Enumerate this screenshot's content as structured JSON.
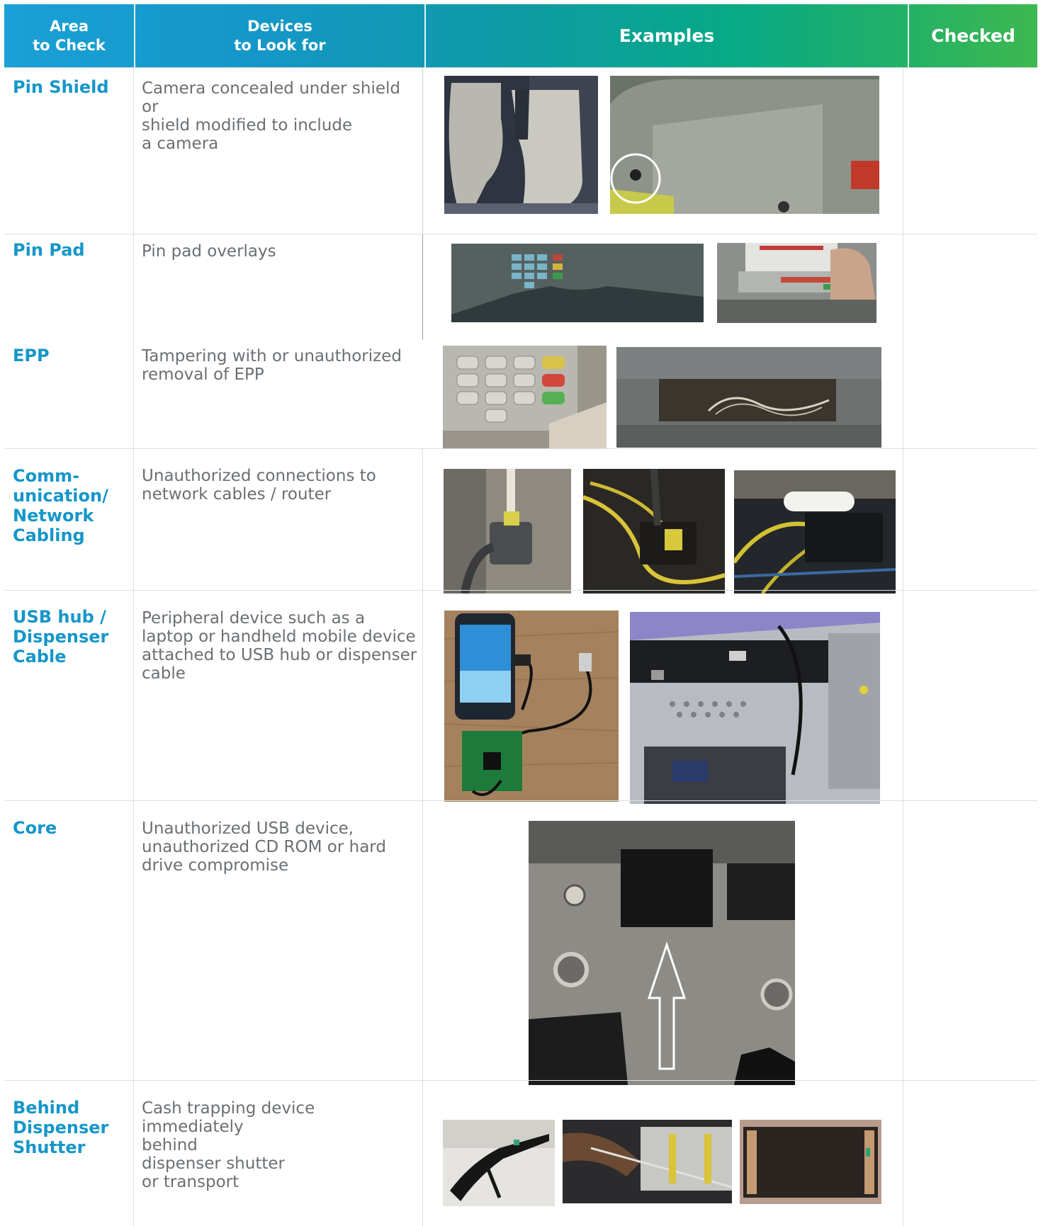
{
  "header": {
    "col1": "Area\nto Check",
    "col2": "Devices\nto Look for",
    "col3": "Examples",
    "col4": "Checked"
  },
  "rows": [
    {
      "area": "Pin Shield",
      "devices": "Camera concealed under shield or\nshield modified to include\na camera",
      "checked": ""
    },
    {
      "area": "Pin Pad",
      "devices": "Pin pad overlays",
      "checked": ""
    },
    {
      "area": "EPP",
      "devices": "Tampering with or unauthorized\nremoval of EPP",
      "checked": ""
    },
    {
      "area": "Comm-\nunication/\nNetwork\nCabling",
      "devices": "Unauthorized connections to\nnetwork cables / router",
      "checked": ""
    },
    {
      "area": "USB hub /\nDispenser\nCable",
      "devices": "Peripheral device such as a\nlaptop or handheld mobile device\nattached to USB hub or dispenser\ncable",
      "checked": ""
    },
    {
      "area": "Core",
      "devices": "Unauthorized USB device,\nunauthorized CD ROM or hard\ndrive compromise",
      "checked": ""
    },
    {
      "area": "Behind\nDispenser\nShutter",
      "devices": "Cash trapping device immediately\nbehind\ndispenser shutter\nor transport",
      "checked": ""
    }
  ],
  "colors": {
    "header_gradient_start": "#1aa0d6",
    "header_gradient_end": "#3db84f",
    "area_text": "#1596c9",
    "description_text": "#6b6f73",
    "grid_line": "#dcdfe2"
  }
}
